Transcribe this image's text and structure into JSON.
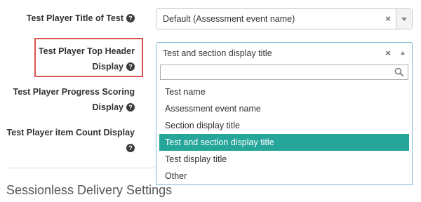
{
  "fields": {
    "title_of_test": {
      "label": "Test Player Title of Test",
      "value": "Default (Assessment event name)",
      "clear": "×"
    },
    "top_header_display": {
      "label_line1": "Test Player Top Header",
      "label_line2": "Display",
      "value": "Test and section display title",
      "clear": "×"
    },
    "progress_scoring": {
      "label_line1": "Test Player Progress Scoring",
      "label_line2": "Display"
    },
    "item_count": {
      "label": "Test Player item Count Display"
    }
  },
  "help_glyph": "?",
  "dropdown": {
    "search_placeholder": "",
    "options": [
      "Test name",
      "Assessment event name",
      "Section display title",
      "Test and section display title",
      "Test display title",
      "Other"
    ],
    "selected_index": 3
  },
  "section": {
    "title": "Sessionless Delivery Settings"
  },
  "colors": {
    "selected_bg": "#26a69a",
    "highlight_border": "#d9534f",
    "focus_border": "#7fb9d9"
  }
}
